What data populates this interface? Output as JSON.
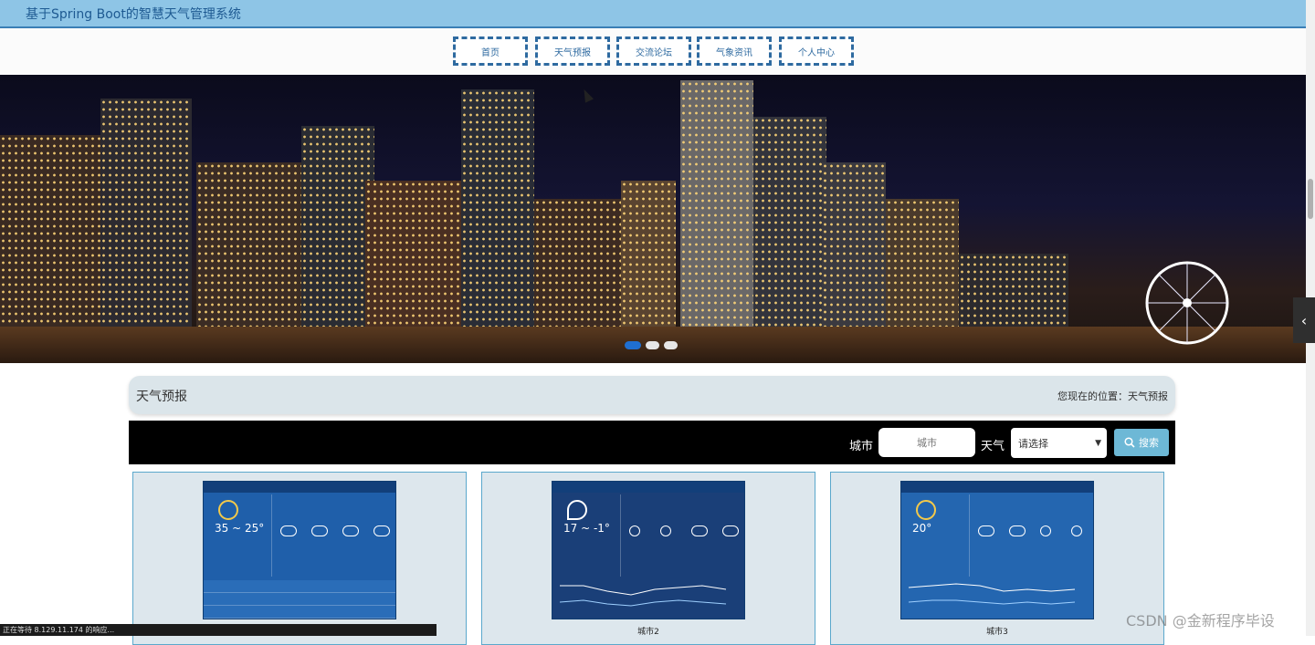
{
  "app": {
    "title": "基于Spring Boot的智慧天气管理系统"
  },
  "nav": {
    "items": [
      "首页",
      "天气预报",
      "交流论坛",
      "气象资讯",
      "个人中心"
    ]
  },
  "banner": {
    "slides": 3,
    "active_slide": 1
  },
  "breadcrumb": {
    "section": "天气预报",
    "position": "您现在的位置：天气预报"
  },
  "search": {
    "city_label": "城市",
    "city_placeholder": "城市",
    "weather_label": "天气",
    "weather_selected": "请选择",
    "button_label": "搜索"
  },
  "cards": [
    {
      "caption": "",
      "temp": "35 ~ 25°"
    },
    {
      "caption": "城市2",
      "temp": "17 ~ -1°"
    },
    {
      "caption": "城市3",
      "temp": "20°"
    }
  ],
  "status": {
    "text": "正在等待 8.129.11.174 的响应..."
  },
  "watermark": "CSDN @金新程序毕设"
}
